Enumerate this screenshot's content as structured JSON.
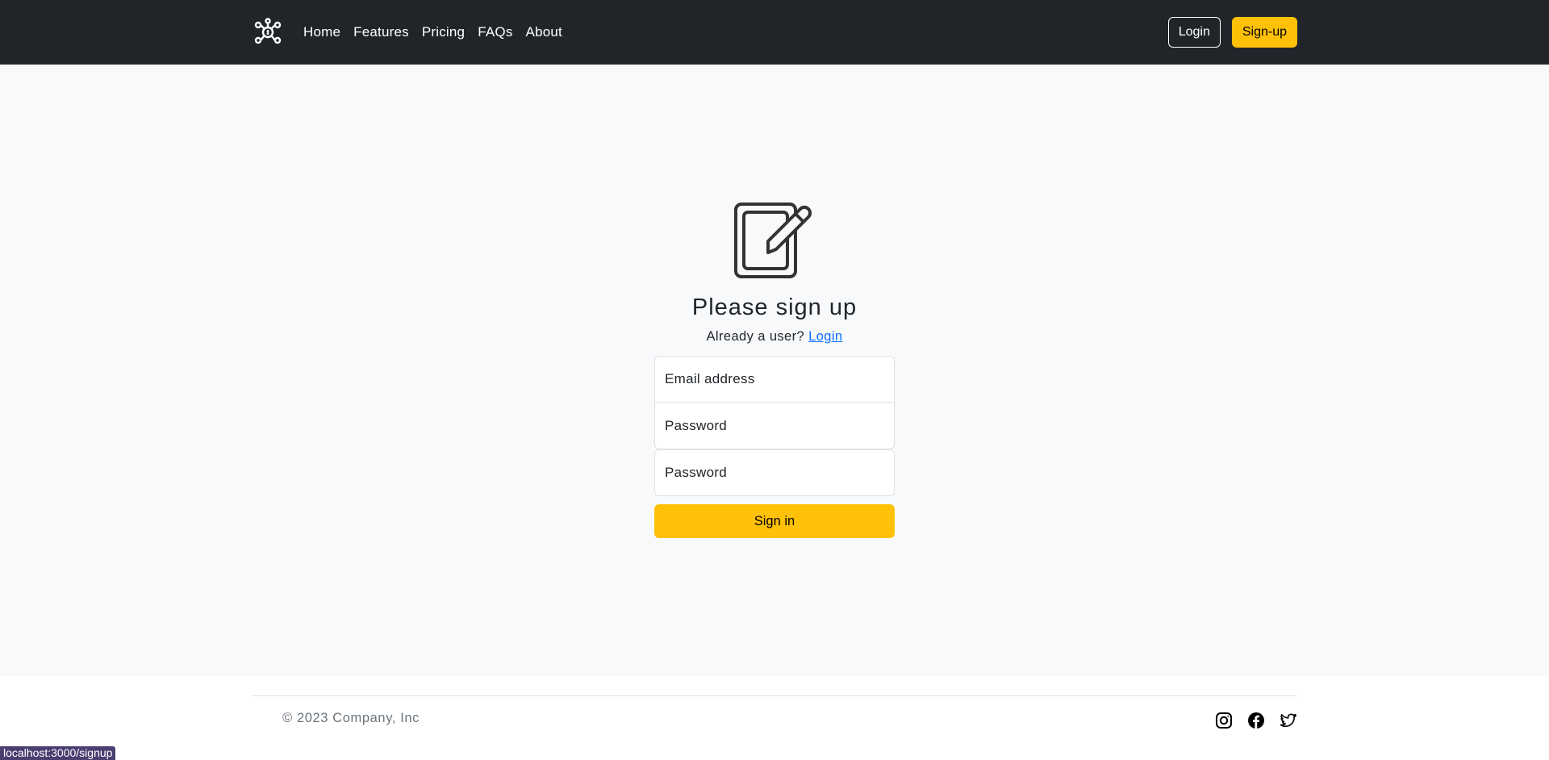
{
  "navbar": {
    "logo_icon": "network-dollar-icon",
    "links": [
      "Home",
      "Features",
      "Pricing",
      "FAQs",
      "About"
    ],
    "login_label": "Login",
    "signup_label": "Sign-up"
  },
  "main": {
    "icon": "pencil-square-icon",
    "heading": "Please sign up",
    "subtext": "Already a user?",
    "login_link": "Login",
    "email_placeholder": "Email address",
    "password_placeholder": "Password",
    "password_confirm_placeholder": "Password",
    "submit_label": "Sign in"
  },
  "footer": {
    "copyright": "© 2023 Company, Inc",
    "social_icons": [
      "instagram-icon",
      "facebook-icon",
      "twitter-icon"
    ]
  },
  "status_bar": {
    "url": "localhost:3000/signup"
  },
  "colors": {
    "navbar_bg": "#212529",
    "accent": "#ffc107",
    "link": "#0d6efd",
    "page_bg": "#f8f9fa"
  }
}
